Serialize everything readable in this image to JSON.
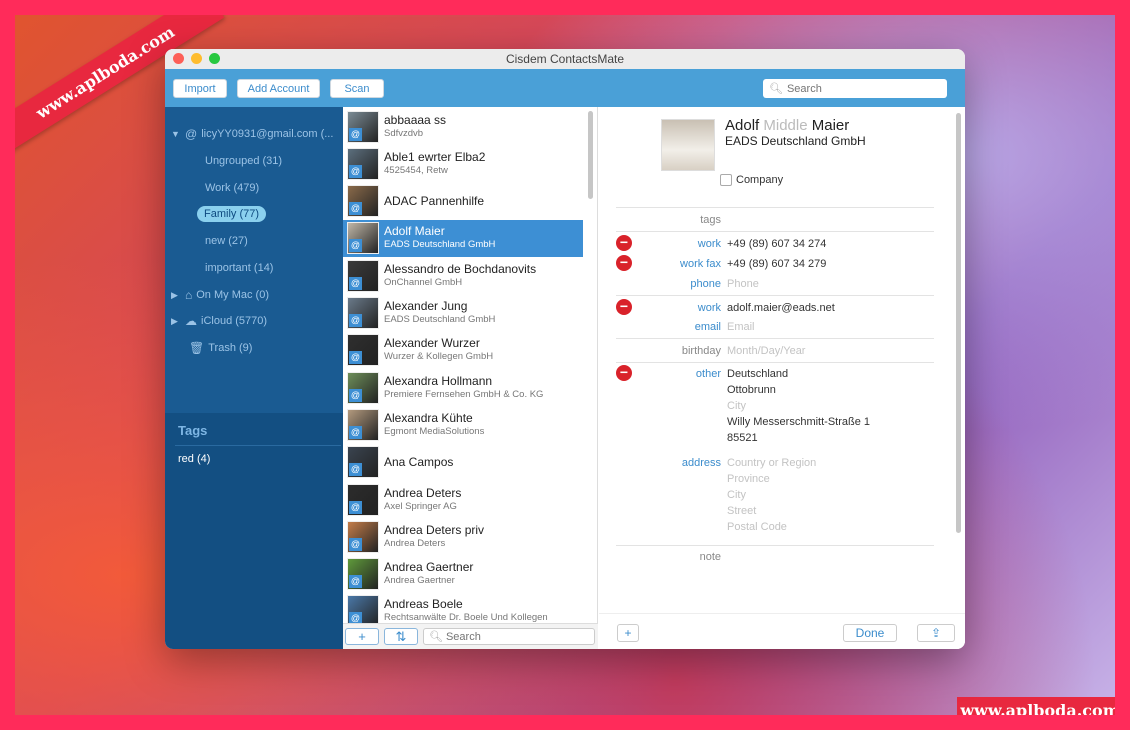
{
  "watermarks": {
    "ribbon": "www.aplboda.com",
    "corner": "www.aplboda.com"
  },
  "window": {
    "title": "Cisdem ContactsMate"
  },
  "toolbar": {
    "import_label": "Import",
    "add_account_label": "Add Account",
    "scan_label": "Scan",
    "search_placeholder": "Search"
  },
  "sidebar": {
    "account": "licyYY0931@gmail.com (...",
    "groups": [
      {
        "label": "Ungrouped (31)"
      },
      {
        "label": "Work (479)"
      },
      {
        "label": "Family (77)"
      },
      {
        "label": "new (27)"
      },
      {
        "label": "important (14)"
      }
    ],
    "on_my_mac": "On My Mac (0)",
    "icloud": "iCloud (5770)",
    "trash": "Trash (9)",
    "tags_heading": "Tags",
    "tags": [
      {
        "label": "red (4)"
      }
    ]
  },
  "contacts": [
    {
      "name": "abbaaaa ss",
      "sub": "Sdfvzdvb"
    },
    {
      "name": "Able1 ewrter Elba2",
      "sub": "4525454, Retw"
    },
    {
      "name": "ADAC Pannenhilfe",
      "sub": ""
    },
    {
      "name": "Adolf Maier",
      "sub": "EADS Deutschland GmbH"
    },
    {
      "name": "Alessandro de Bochdanovits",
      "sub": "OnChannel GmbH"
    },
    {
      "name": "Alexander Jung",
      "sub": "EADS Deutschland GmbH"
    },
    {
      "name": "Alexander Wurzer",
      "sub": "Wurzer & Kollegen GmbH"
    },
    {
      "name": "Alexandra Hollmann",
      "sub": "Premiere Fernsehen GmbH & Co. KG"
    },
    {
      "name": "Alexandra Kühte",
      "sub": "Egmont MediaSolutions"
    },
    {
      "name": "Ana Campos",
      "sub": ""
    },
    {
      "name": "Andrea Deters",
      "sub": "Axel Springer AG"
    },
    {
      "name": "Andrea Deters priv",
      "sub": "Andrea Deters"
    },
    {
      "name": "Andrea Gaertner",
      "sub": "Andrea Gaertner"
    },
    {
      "name": "Andreas Boele",
      "sub": "Rechtsanwälte Dr. Boele Und Kollegen"
    }
  ],
  "list_bottom": {
    "add_label": "+",
    "sort_label": "⇅",
    "search_placeholder": "Search"
  },
  "detail": {
    "first": "Adolf",
    "middle": "Middle",
    "last": "Maier",
    "company": "EADS Deutschland GmbH",
    "company_checkbox": "Company",
    "tags_label": "tags",
    "phones": [
      {
        "label": "work",
        "value": "+49 (89) 607 34 274"
      },
      {
        "label": "work fax",
        "value": "+49 (89) 607 34 279"
      },
      {
        "label": "phone",
        "value": "Phone"
      }
    ],
    "emails": [
      {
        "label": "work",
        "value": "adolf.maier@eads.net"
      },
      {
        "label": "email",
        "value": "Email"
      }
    ],
    "birthday_label": "birthday",
    "birthday_placeholder": "Month/Day/Year",
    "other_label": "other",
    "other_address": [
      "Deutschland",
      "Ottobrunn",
      "City",
      "Willy Messerschmitt-Straße 1",
      "85521"
    ],
    "address_label": "address",
    "address_placeholders": [
      "Country or Region",
      "Province",
      "City",
      "Street",
      "Postal Code"
    ],
    "note_label": "note",
    "add_label": "+",
    "done_label": "Done",
    "share_icon": "share-icon"
  }
}
